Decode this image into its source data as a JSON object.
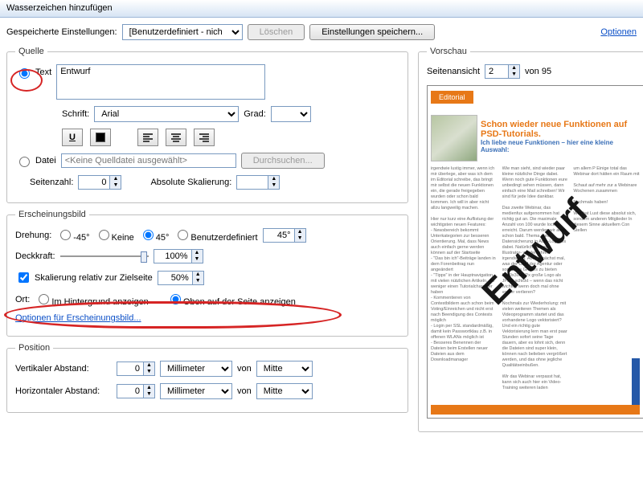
{
  "window": {
    "title": "Wasserzeichen hinzufügen"
  },
  "top": {
    "saved_label": "Gespeicherte Einstellungen:",
    "saved_value": "[Benutzerdefiniert - nich",
    "delete": "Löschen",
    "save": "Einstellungen speichern...",
    "options": "Optionen"
  },
  "source": {
    "legend": "Quelle",
    "text_radio": "Text",
    "text_value": "Entwurf",
    "font_label": "Schrift:",
    "font_value": "Arial",
    "size_label": "Grad:",
    "size_value": "",
    "file_radio": "Datei",
    "file_display": "<Keine Quelldatei ausgewählt>",
    "browse": "Durchsuchen...",
    "pagecount_label": "Seitenzahl:",
    "pagecount_value": "0",
    "absscale_label": "Absolute Skalierung:",
    "absscale_value": ""
  },
  "appearance": {
    "legend": "Erscheinungsbild",
    "rotation_label": "Drehung:",
    "rot_m45": "-45°",
    "rot_none": "Keine",
    "rot_45": "45°",
    "rot_custom": "Benutzerdefiniert",
    "rot_custom_val": "45°",
    "opacity_label": "Deckkraft:",
    "opacity_value": "100%",
    "relscale_label": "Skalierung relativ zur Zielseite",
    "relscale_value": "50%",
    "location_label": "Ort:",
    "behind": "Im Hintergrund anzeigen",
    "ontop": "Oben auf der Seite anzeigen",
    "options_link": "Optionen für Erscheinungsbild..."
  },
  "position": {
    "legend": "Position",
    "vdist_label": "Vertikaler Abstand:",
    "hdist_label": "Horizontaler Abstand:",
    "value": "0",
    "unit": "Millimeter",
    "from": "von",
    "anchor": "Mitte"
  },
  "preview": {
    "legend": "Vorschau",
    "pageview_label": "Seitenansicht",
    "page_current": "2",
    "page_total": "von 95",
    "editorial": "Editorial",
    "headline": "Schon wieder neue Funktionen auf PSD-Tutorials.",
    "subhead": "Ich liebe neue Funktionen – hier eine kleine Auswahl:",
    "watermark": "Entwurf"
  }
}
